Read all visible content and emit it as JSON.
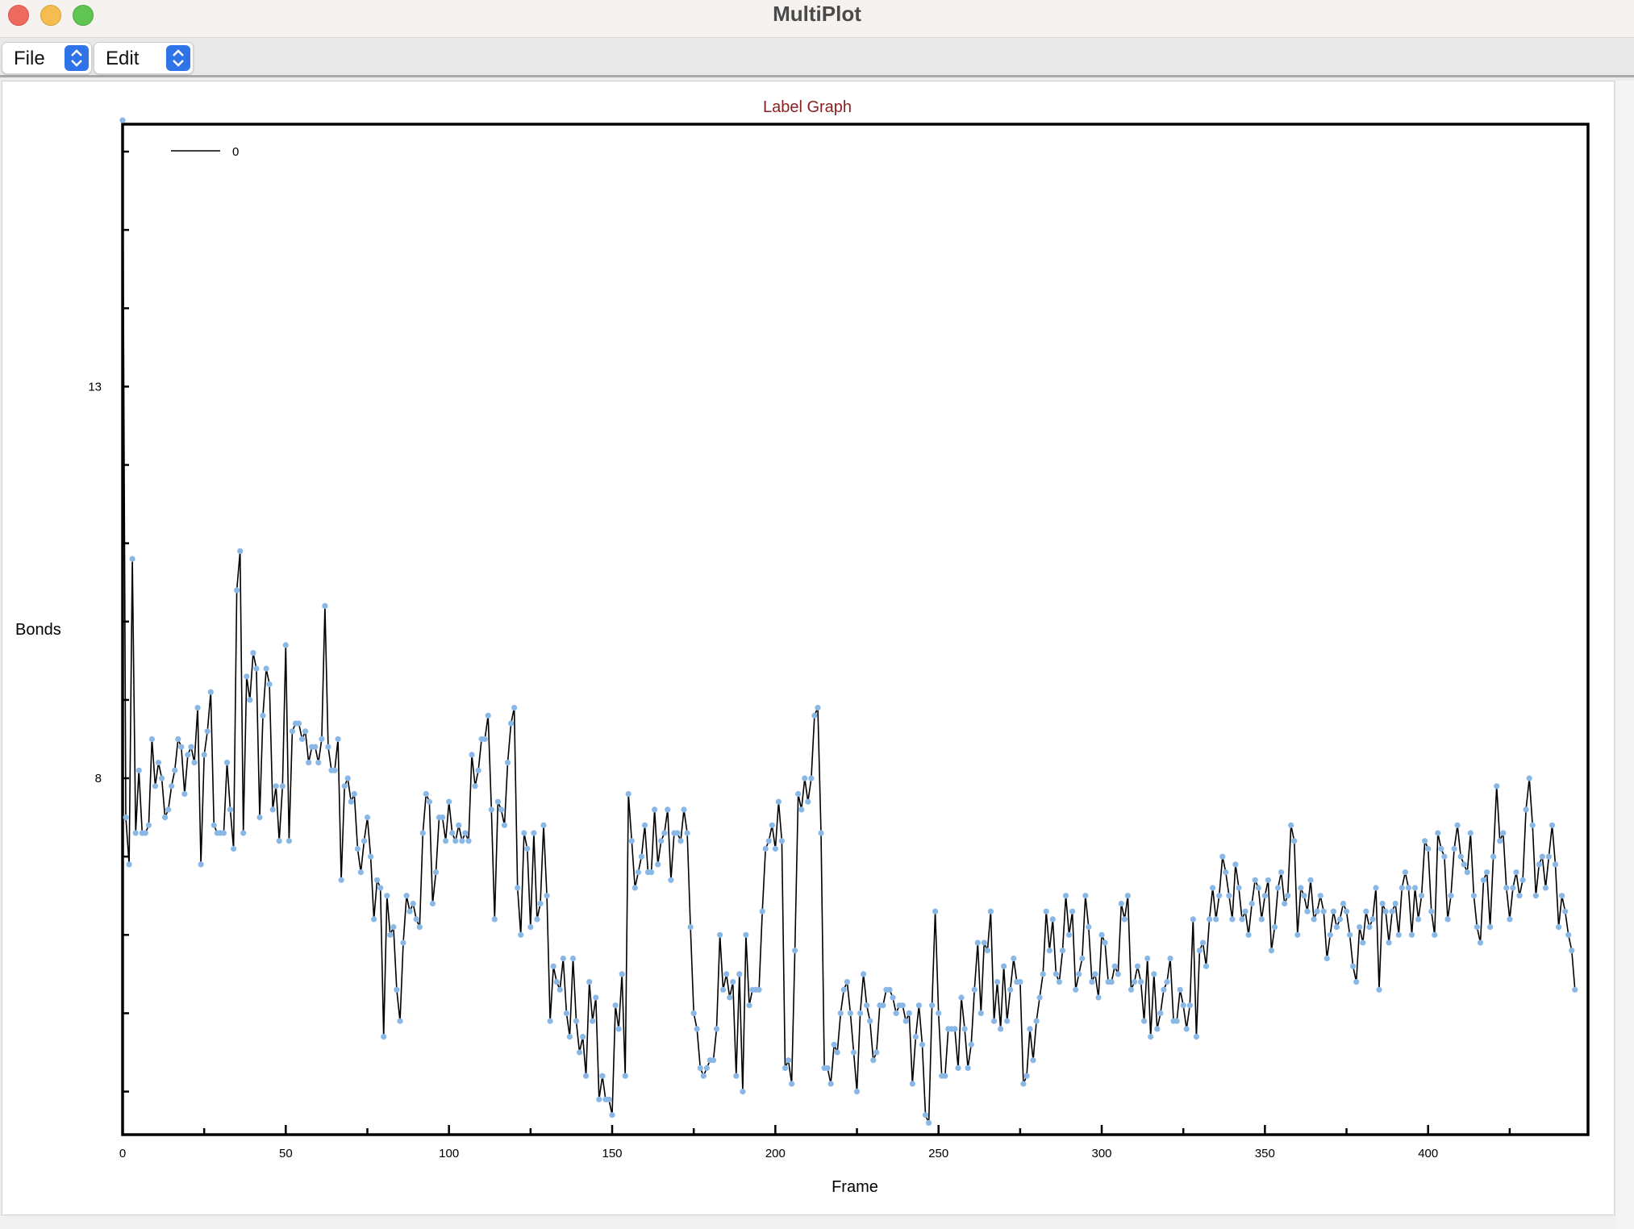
{
  "window": {
    "title": "MultiPlot"
  },
  "menus": [
    {
      "label": "File"
    },
    {
      "label": "Edit"
    }
  ],
  "colors": {
    "title": "#8b1f1f",
    "line": "#000000",
    "markers": "#8ab8e6",
    "panel": "#ffffff"
  },
  "icons": [
    "close-window-light",
    "minimize-window-light",
    "maximize-window-light",
    "updown-chevron-icon"
  ],
  "chart_data": {
    "type": "line",
    "title": "Label Graph",
    "xlabel": "Frame",
    "ylabel": "Bonds",
    "xlim": [
      0,
      449
    ],
    "ylim": [
      3.45,
      16.35
    ],
    "x_ticks": [
      0,
      50,
      100,
      150,
      200,
      250,
      300,
      350,
      400
    ],
    "y_tick_labels": [
      13,
      8
    ],
    "y_ticks_all": [
      4,
      5,
      6,
      7,
      8,
      9,
      10,
      11,
      12,
      13,
      14,
      15,
      16
    ],
    "grid": false,
    "legend": {
      "position": "top-left",
      "entries": [
        "0"
      ]
    },
    "series": [
      {
        "name": "0",
        "x_start": 0,
        "x_step": 1,
        "values": [
          16.4,
          7.5,
          6.9,
          10.8,
          7.3,
          8.1,
          7.3,
          7.3,
          7.4,
          8.5,
          7.9,
          8.2,
          8.0,
          7.5,
          7.6,
          7.9,
          8.1,
          8.5,
          8.4,
          7.8,
          8.3,
          8.4,
          8.2,
          8.9,
          6.9,
          8.3,
          8.6,
          9.1,
          7.4,
          7.3,
          7.3,
          7.3,
          8.2,
          7.6,
          7.1,
          10.4,
          10.9,
          7.3,
          9.3,
          9.0,
          9.6,
          9.4,
          7.5,
          8.8,
          9.4,
          9.2,
          7.6,
          7.9,
          7.2,
          7.9,
          9.7,
          7.2,
          8.6,
          8.7,
          8.7,
          8.5,
          8.6,
          8.2,
          8.4,
          8.4,
          8.2,
          8.5,
          10.2,
          8.4,
          8.1,
          8.1,
          8.5,
          6.7,
          7.9,
          8.0,
          7.7,
          7.8,
          7.1,
          6.8,
          7.2,
          7.5,
          7.0,
          6.2,
          6.7,
          6.6,
          4.7,
          6.5,
          6.0,
          6.1,
          5.3,
          4.9,
          5.9,
          6.5,
          6.3,
          6.4,
          6.2,
          6.1,
          7.3,
          7.8,
          7.7,
          6.4,
          6.8,
          7.5,
          7.5,
          7.2,
          7.7,
          7.3,
          7.2,
          7.4,
          7.2,
          7.3,
          7.2,
          8.3,
          7.9,
          8.1,
          8.5,
          8.5,
          8.8,
          7.6,
          6.2,
          7.7,
          7.6,
          7.4,
          8.2,
          8.7,
          8.9,
          6.6,
          6.0,
          7.3,
          7.1,
          6.1,
          7.3,
          6.2,
          6.4,
          7.4,
          6.5,
          4.9,
          5.6,
          5.4,
          5.3,
          5.7,
          5.0,
          4.7,
          5.7,
          4.9,
          4.5,
          4.7,
          4.2,
          5.4,
          4.9,
          5.2,
          3.9,
          4.2,
          3.9,
          3.9,
          3.7,
          5.1,
          4.8,
          5.5,
          4.2,
          7.8,
          7.2,
          6.6,
          6.8,
          7.0,
          7.4,
          6.8,
          6.8,
          7.6,
          6.9,
          7.2,
          7.3,
          7.6,
          6.7,
          7.3,
          7.3,
          7.2,
          7.6,
          7.3,
          6.1,
          5.0,
          4.8,
          4.3,
          4.2,
          4.3,
          4.4,
          4.4,
          4.8,
          6.0,
          5.3,
          5.5,
          5.2,
          5.4,
          4.2,
          5.5,
          4.0,
          6.0,
          5.1,
          5.3,
          5.3,
          5.3,
          6.3,
          7.1,
          7.2,
          7.4,
          7.1,
          7.7,
          7.2,
          4.3,
          4.4,
          4.1,
          5.8,
          7.8,
          7.6,
          8.0,
          7.7,
          8.0,
          8.8,
          8.9,
          7.3,
          4.3,
          4.3,
          4.1,
          4.6,
          4.5,
          5.0,
          5.3,
          5.4,
          5.0,
          4.5,
          4.0,
          5.0,
          5.5,
          5.1,
          4.9,
          4.4,
          4.5,
          5.1,
          5.1,
          5.3,
          5.3,
          5.2,
          5.0,
          5.1,
          5.1,
          4.9,
          5.0,
          4.1,
          4.7,
          5.1,
          4.6,
          3.7,
          3.6,
          5.1,
          6.3,
          5.0,
          4.2,
          4.2,
          4.8,
          4.8,
          4.8,
          4.3,
          5.2,
          4.8,
          4.3,
          4.6,
          5.3,
          5.9,
          5.0,
          5.9,
          5.8,
          6.3,
          4.9,
          5.4,
          4.8,
          5.6,
          4.9,
          5.3,
          5.7,
          5.4,
          5.4,
          4.1,
          4.2,
          4.8,
          4.4,
          4.9,
          5.2,
          5.5,
          6.3,
          5.8,
          6.2,
          5.5,
          5.4,
          5.8,
          6.5,
          6.0,
          6.3,
          5.3,
          5.5,
          5.7,
          6.5,
          6.1,
          5.4,
          5.5,
          5.2,
          6.0,
          5.9,
          5.4,
          5.4,
          5.6,
          5.5,
          6.4,
          6.2,
          6.5,
          5.3,
          5.4,
          5.6,
          5.4,
          4.9,
          5.7,
          4.7,
          5.5,
          4.8,
          5.0,
          5.3,
          5.4,
          5.7,
          4.9,
          4.9,
          5.3,
          5.1,
          4.8,
          5.1,
          6.2,
          4.7,
          5.8,
          5.9,
          5.6,
          6.2,
          6.6,
          6.2,
          6.5,
          7.0,
          6.8,
          6.5,
          6.2,
          6.9,
          6.6,
          6.2,
          6.3,
          6.0,
          6.4,
          6.7,
          6.6,
          6.2,
          6.5,
          6.7,
          5.8,
          6.1,
          6.6,
          6.8,
          6.4,
          6.5,
          7.4,
          7.2,
          6.0,
          6.6,
          6.5,
          6.3,
          6.7,
          6.2,
          6.3,
          6.5,
          6.3,
          5.7,
          6.0,
          6.3,
          6.1,
          6.2,
          6.4,
          6.3,
          6.0,
          5.6,
          5.4,
          6.1,
          5.9,
          6.3,
          6.1,
          6.2,
          6.6,
          5.3,
          6.4,
          6.3,
          5.9,
          6.3,
          6.4,
          6.0,
          6.6,
          6.8,
          6.6,
          6.0,
          6.6,
          6.2,
          6.5,
          7.2,
          7.1,
          6.3,
          6.0,
          7.3,
          7.1,
          7.0,
          6.2,
          6.5,
          7.1,
          7.4,
          7.0,
          6.9,
          6.8,
          7.3,
          6.5,
          6.1,
          5.9,
          6.7,
          6.8,
          6.1,
          7.0,
          7.9,
          7.2,
          7.3,
          6.6,
          6.2,
          6.6,
          6.8,
          6.5,
          6.7,
          7.6,
          8.0,
          7.4,
          6.5,
          6.9,
          7.0,
          6.6,
          7.0,
          7.4,
          6.9,
          6.1,
          6.5,
          6.3,
          6.0,
          5.8,
          5.3
        ]
      }
    ]
  }
}
